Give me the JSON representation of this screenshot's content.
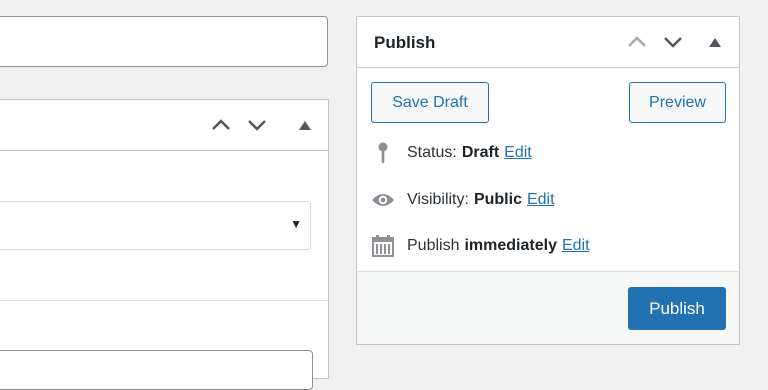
{
  "publish": {
    "title": "Publish",
    "save_draft_label": "Save Draft",
    "preview_label": "Preview",
    "status": {
      "label": "Status:",
      "value": "Draft",
      "edit": "Edit"
    },
    "visibility": {
      "label": "Visibility:",
      "value": "Public",
      "edit": "Edit"
    },
    "schedule": {
      "label": "Publish",
      "value": "immediately",
      "edit": "Edit"
    },
    "publish_button_label": "Publish"
  },
  "left_box": {
    "select_arrow": "▼"
  },
  "icons": {
    "move_up": "chevron-up-icon",
    "move_down": "chevron-down-icon",
    "toggle": "triangle-up-icon",
    "status": "pin-icon",
    "visibility": "eye-icon",
    "schedule": "calendar-icon"
  },
  "colors": {
    "accent": "#2271b1",
    "background": "#f0f0f1",
    "panel": "#ffffff",
    "footer": "#f6f7f7",
    "icon": "#8c8f94"
  }
}
